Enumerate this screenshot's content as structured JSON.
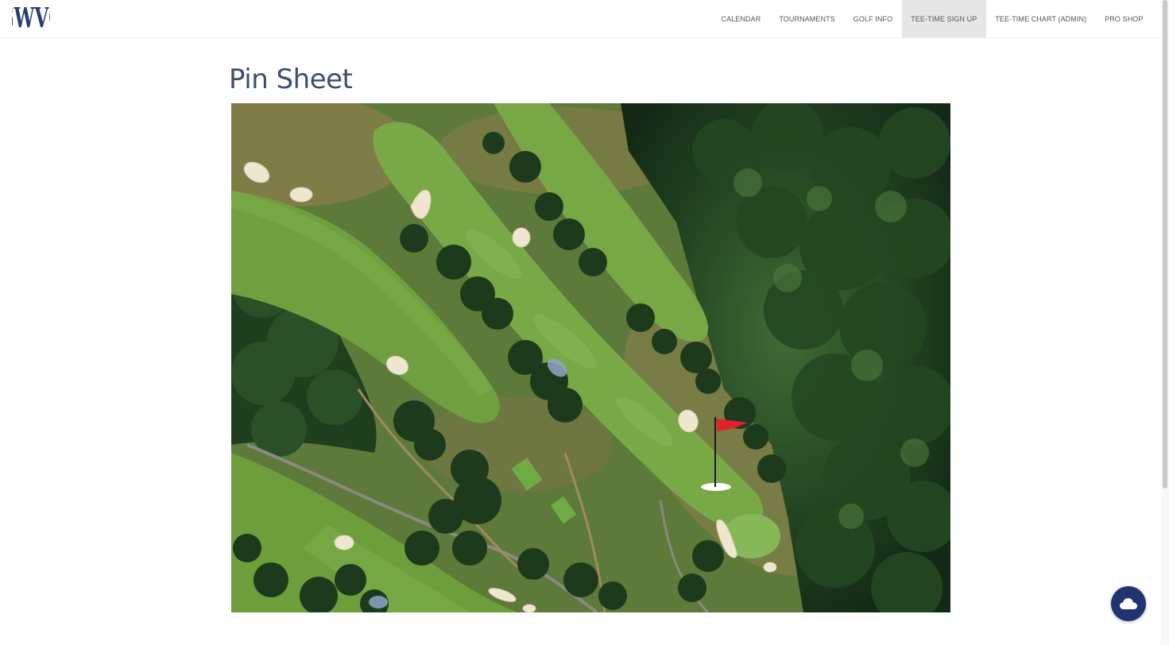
{
  "brand": {
    "logo_text": "GWVC"
  },
  "nav": {
    "items": [
      {
        "label": "CALENDAR"
      },
      {
        "label": "TOURNAMENTS"
      },
      {
        "label": "GOLF INFO"
      },
      {
        "label": "TEE-TIME SIGN UP"
      },
      {
        "label": "TEE-TIME CHART (ADMIN)"
      },
      {
        "label": "PRO SHOP"
      }
    ],
    "active_label": "TEE-TIME SIGN UP"
  },
  "page": {
    "title": "Pin Sheet"
  },
  "map": {
    "type": "aerial golf course view",
    "pin_flag_color": "#e0232b"
  },
  "chat": {
    "icon": "cloud-icon"
  },
  "colors": {
    "nav_active_bg": "#e6e6e6",
    "title": "#3c4f73",
    "chat_button": "#1f3470"
  }
}
